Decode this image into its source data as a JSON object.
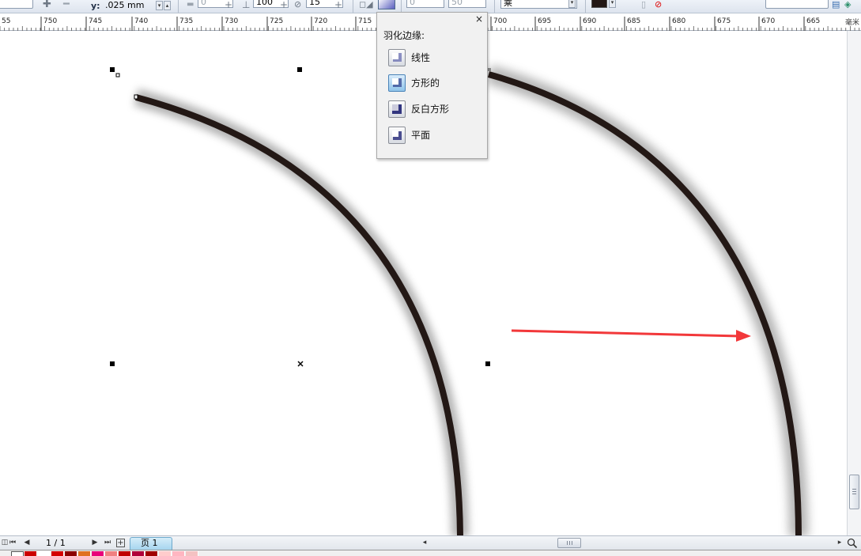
{
  "property_bar": {
    "y_label": "y:",
    "y_value": ".025 mm",
    "spin_a_value": "0",
    "spin_b_value": "100",
    "spin_c_value": "15",
    "spin_d_value": "0",
    "spin_e_value": "50",
    "dropdown_value": "乘"
  },
  "ruler": {
    "unit_label": "毫米",
    "ticks": [
      "55",
      "750",
      "745",
      "740",
      "735",
      "730",
      "725",
      "720",
      "715",
      "700",
      "695",
      "690",
      "685",
      "680",
      "675",
      "670",
      "665"
    ]
  },
  "feather_popup": {
    "title": "羽化边缘:",
    "close_label": "×",
    "options": [
      {
        "label": "线性",
        "selected": false
      },
      {
        "label": "方形的",
        "selected": true
      },
      {
        "label": "反白方形",
        "selected": false
      },
      {
        "label": "平面",
        "selected": false
      }
    ]
  },
  "page_nav": {
    "first_label": "⏮",
    "prev_label": "◀",
    "page_count": "1 / 1",
    "next_label": "▶",
    "last_label": "⏭",
    "add_page_label": "+",
    "page_tab_label": "页 1"
  },
  "colors": {
    "curve": "#231815",
    "arrow": "#f2383a",
    "accent_tab": "#a6d5ef"
  },
  "palette": [
    "#cc0000",
    "#ffffff",
    "#d40000",
    "#8b0000",
    "#e07020",
    "#e8007a",
    "#f08080",
    "#c00000",
    "#b0003a",
    "#a00000",
    "#ffcccc",
    "#ffb6c1",
    "#f4c2c2"
  ]
}
